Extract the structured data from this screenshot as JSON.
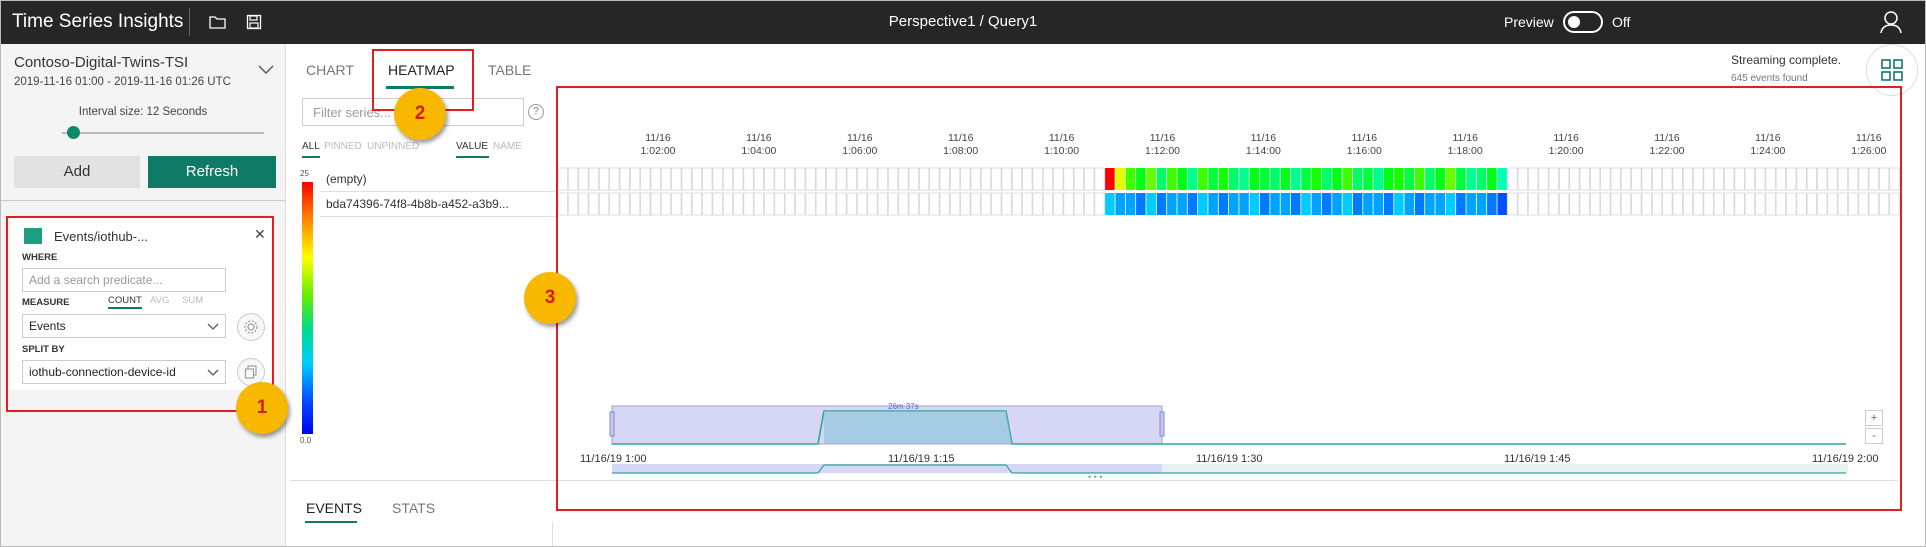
{
  "app": {
    "brand": "Time Series Insights",
    "title": "Perspective1 / Query1",
    "preview_label": "Preview",
    "preview_state": "Off"
  },
  "environment": {
    "name": "Contoso-Digital-Twins-TSI",
    "time_range": "2019-11-16 01:00  -  2019-11-16 01:26 UTC",
    "interval_label": "Interval size: 12 Seconds",
    "interval_slider_fraction": 0.03
  },
  "actions": {
    "add": "Add",
    "refresh": "Refresh"
  },
  "query": {
    "name": "Events/iothub-...",
    "color": "#1c9e83",
    "where_label": "WHERE",
    "where_placeholder": "Add a search predicate...",
    "measure_label": "MEASURE",
    "measure_options": [
      "COUNT",
      "AVG",
      "SUM"
    ],
    "measure_selected": "COUNT",
    "measure_value": "Events",
    "split_label": "SPLIT BY",
    "split_value": "iothub-connection-device-id"
  },
  "tabs": [
    "CHART",
    "HEATMAP",
    "TABLE"
  ],
  "active_tab": "HEATMAP",
  "filter": {
    "placeholder": "Filter series...",
    "options": [
      "ALL",
      "PINNED",
      "UNPINNED",
      "VALUE",
      "NAME"
    ],
    "selected": [
      "ALL",
      "VALUE"
    ]
  },
  "status": {
    "line1": "Streaming complete.",
    "line2": "645 events found"
  },
  "legend": {
    "max": "25",
    "min": "0.0"
  },
  "chart_data": {
    "type": "heatmap",
    "series": [
      {
        "name": "(empty)",
        "values": [
          25,
          18,
          14,
          12,
          15,
          10,
          14,
          12,
          9,
          14,
          11,
          13,
          10,
          9,
          12,
          11,
          10,
          12,
          9,
          11,
          13,
          10,
          12,
          14,
          10,
          11,
          9,
          12,
          13,
          11,
          14,
          10,
          12,
          15,
          11,
          9,
          10,
          12,
          8
        ]
      },
      {
        "name": "bda74396-74f8-4b8b-a452-a3b9...",
        "values": [
          5,
          4,
          4,
          3,
          5,
          3,
          4,
          4,
          3,
          5,
          4,
          3,
          4,
          4,
          5,
          3,
          4,
          4,
          3,
          5,
          4,
          3,
          4,
          5,
          3,
          4,
          4,
          3,
          5,
          4,
          3,
          4,
          4,
          5,
          3,
          4,
          4,
          3,
          2
        ]
      }
    ],
    "data_start_index": 53,
    "total_bins": 130,
    "x_ticks": [
      [
        "11/16",
        "1:02:00"
      ],
      [
        "11/16",
        "1:04:00"
      ],
      [
        "11/16",
        "1:06:00"
      ],
      [
        "11/16",
        "1:08:00"
      ],
      [
        "11/16",
        "1:10:00"
      ],
      [
        "11/16",
        "1:12:00"
      ],
      [
        "11/16",
        "1:14:00"
      ],
      [
        "11/16",
        "1:16:00"
      ],
      [
        "11/16",
        "1:18:00"
      ],
      [
        "11/16",
        "1:20:00"
      ],
      [
        "11/16",
        "1:22:00"
      ],
      [
        "11/16",
        "1:24:00"
      ],
      [
        "11/16",
        "1:26:00"
      ]
    ],
    "legend_range": [
      0,
      25
    ],
    "brush_duration": "26m 37s",
    "brush_axis": [
      "11/16/19 1:00",
      "11/16/19 1:15",
      "11/16/19 1:30",
      "11/16/19 1:45",
      "11/16/19 2:00"
    ]
  },
  "zoom": {
    "plus": "+",
    "minus": "-"
  },
  "bottom_tabs": [
    "EVENTS",
    "STATS"
  ],
  "annotations": [
    "1",
    "2",
    "3"
  ]
}
